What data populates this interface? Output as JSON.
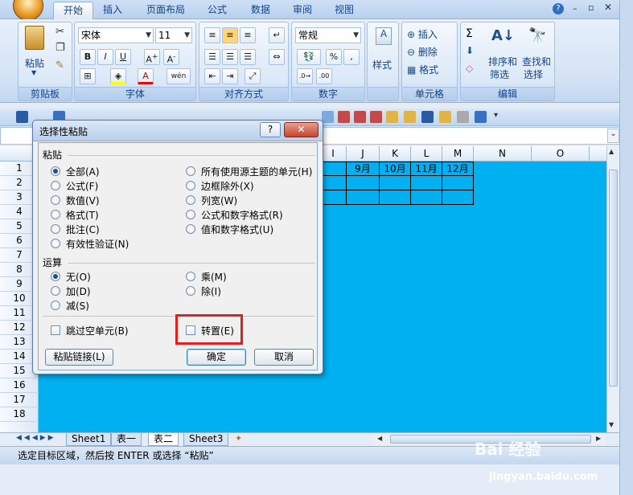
{
  "ribbon": {
    "tabs": [
      "开始",
      "插入",
      "页面布局",
      "公式",
      "数据",
      "审阅",
      "视图"
    ],
    "font_name": "宋体",
    "font_size": "11",
    "number_format": "常规",
    "groups": {
      "clipboard": "剪贴板",
      "font": "字体",
      "alignment": "对齐方式",
      "number": "数字",
      "styles": "样式",
      "cells": "单元格",
      "editing": "编辑"
    },
    "paste": "粘贴",
    "style_btn": "样式",
    "insert": "插入",
    "delete": "删除",
    "format": "格式",
    "sort_filter_1": "排序和",
    "sort_filter_2": "筛选",
    "find_select_1": "查找和",
    "find_select_2": "选择",
    "bold": "B",
    "italic": "I",
    "underline": "U",
    "currency": "%"
  },
  "sheet": {
    "columns": [
      "I",
      "J",
      "K",
      "L",
      "M",
      "N",
      "O"
    ],
    "rows": [
      "1",
      "2",
      "3",
      "4",
      "5",
      "6",
      "7",
      "8",
      "9",
      "10",
      "11",
      "12",
      "13",
      "14",
      "15",
      "16",
      "17",
      "18"
    ],
    "month_cells": [
      "9月",
      "10月",
      "11月",
      "12月"
    ],
    "tabs": [
      "Sheet1",
      "表一",
      "表二",
      "Sheet3"
    ],
    "active_tab": "表二"
  },
  "status": "选定目标区域，然后按 ENTER 或选择 “粘贴”",
  "dialog": {
    "title": "选择性粘贴",
    "paste_section": "粘贴",
    "paste_options_left": [
      "全部(A)",
      "公式(F)",
      "数值(V)",
      "格式(T)",
      "批注(C)",
      "有效性验证(N)"
    ],
    "paste_options_right": [
      "所有使用源主题的单元(H)",
      "边框除外(X)",
      "列宽(W)",
      "公式和数字格式(R)",
      "值和数字格式(U)"
    ],
    "operation_section": "运算",
    "operation_left": [
      "无(O)",
      "加(D)",
      "减(S)"
    ],
    "operation_right": [
      "乘(M)",
      "除(I)"
    ],
    "skip_blanks": "跳过空单元(B)",
    "transpose": "转置(E)",
    "paste_link": "粘贴链接(L)",
    "ok": "确定",
    "cancel": "取消",
    "help": "?",
    "close": "✕"
  },
  "watermark": {
    "logo": "Bai 经验",
    "url": "jingyan.baidu.com"
  },
  "colors": {
    "sheet_fill": "#00b0f0",
    "highlight": "#e41e1e"
  }
}
